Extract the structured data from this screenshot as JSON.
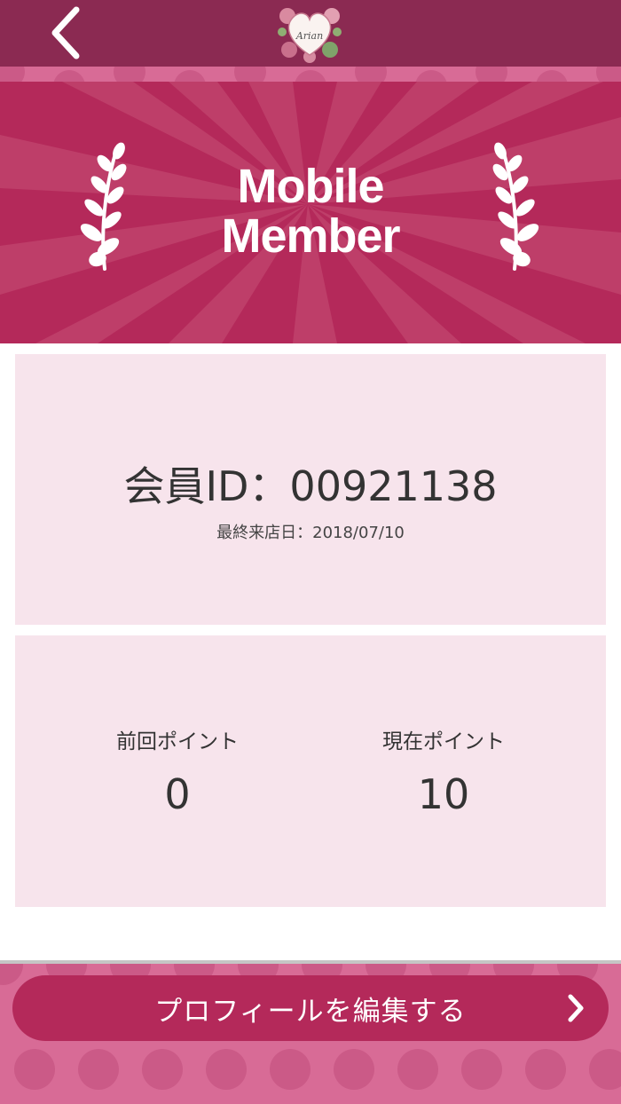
{
  "header": {
    "back_icon": "chevron-left-icon",
    "logo_text": "Arian",
    "bar_color": "#8b2a52"
  },
  "banner": {
    "title_line1": "Mobile",
    "title_line2": "Member",
    "color": "#b4295a"
  },
  "member": {
    "id_text": "会員ID：00921138",
    "last_visit_text": "最終来店日：2018/07/10"
  },
  "points": {
    "previous_label": "前回ポイント",
    "previous_value": "0",
    "current_label": "現在ポイント",
    "current_value": "10"
  },
  "actions": {
    "edit_profile_label": "プロフィールを編集する",
    "edit_profile_icon": "chevron-right-icon"
  },
  "colors": {
    "accent": "#b4295a",
    "card_bg": "#f7e4ec",
    "dots_bg": "#d86b96"
  }
}
